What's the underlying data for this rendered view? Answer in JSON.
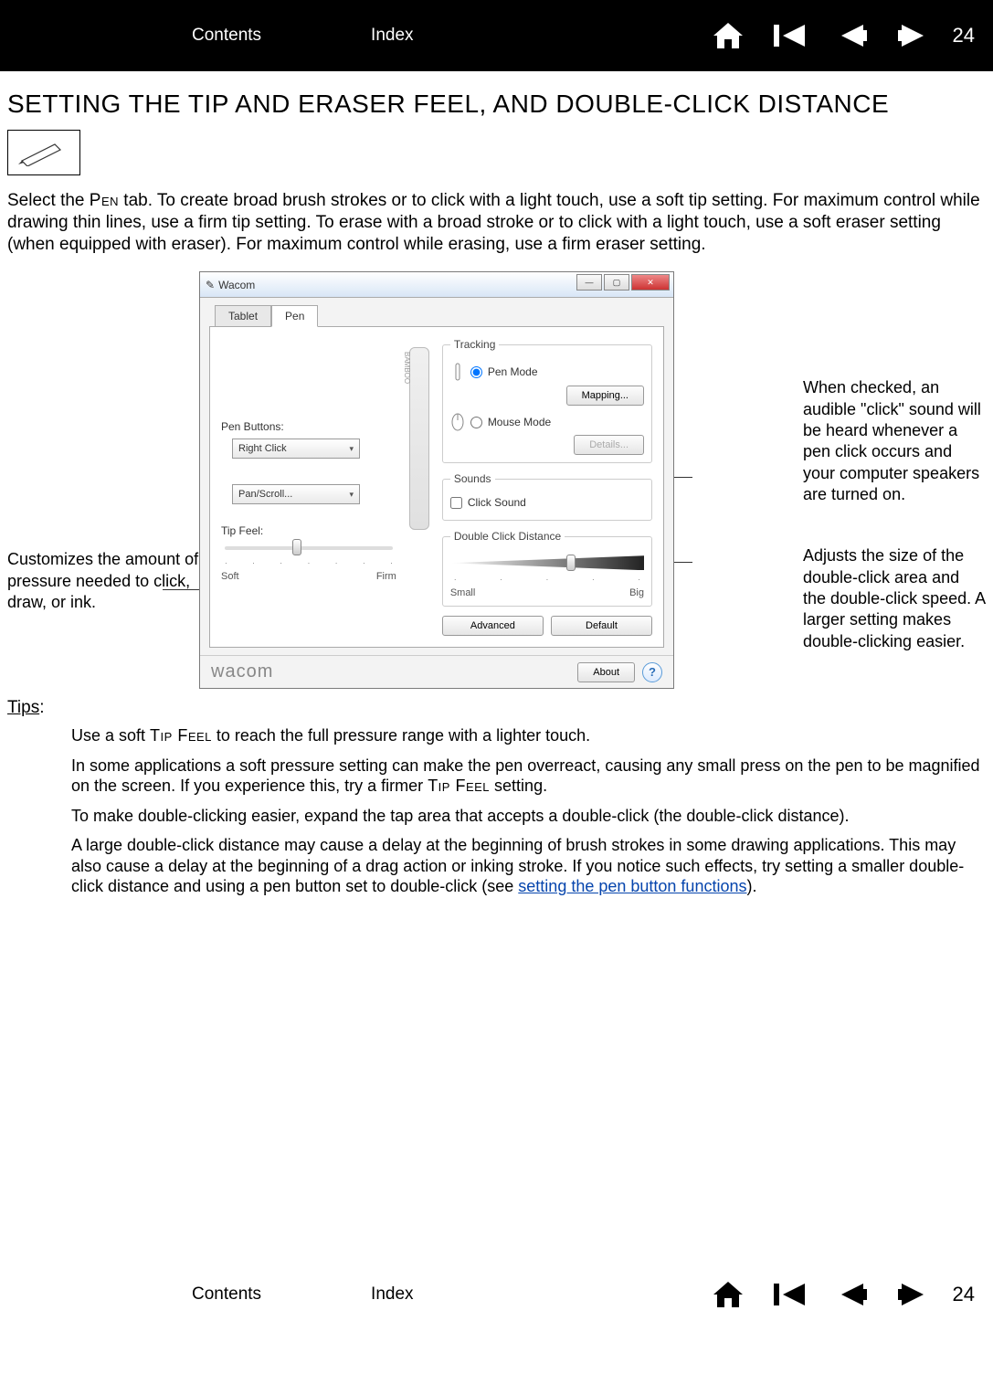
{
  "nav": {
    "contents": "Contents",
    "index": "Index",
    "page_number": "24"
  },
  "heading": "SETTING THE TIP AND ERASER FEEL, AND DOUBLE-CLICK DISTANCE",
  "intro_pre": "Select the ",
  "intro_pen": "Pen",
  "intro_post": " tab. To create broad brush strokes or to click with a light touch, use a soft tip setting. For maximum control while drawing thin lines, use a firm tip setting. To erase with a broad stroke or to click with a light touch, use a soft eraser setting (when equipped with eraser). For maximum control while erasing, use a firm eraser setting.",
  "callouts": {
    "left": "Customizes the amount of pressure needed to click, draw, or ink.",
    "right1": "When checked, an audible \"click\" sound will be heard whenever a pen click occurs and your computer speakers are turned on.",
    "right2": "Adjusts the size of the double-click area and the double-click speed. A larger setting makes double-clicking easier."
  },
  "window": {
    "title": "Wacom",
    "tabs": {
      "tablet": "Tablet",
      "pen": "Pen"
    },
    "pen_buttons_label": "Pen Buttons:",
    "dropdown1": "Right Click",
    "dropdown2": "Pan/Scroll...",
    "tip_feel_label": "Tip Feel:",
    "tip_feel_left": "Soft",
    "tip_feel_right": "Firm",
    "tracking_legend": "Tracking",
    "pen_mode": "Pen Mode",
    "mapping_btn": "Mapping...",
    "mouse_mode": "Mouse Mode",
    "details_btn": "Details...",
    "sounds_legend": "Sounds",
    "click_sound": "Click Sound",
    "dcd_legend": "Double Click Distance",
    "dcd_left": "Small",
    "dcd_right": "Big",
    "advanced_btn": "Advanced",
    "default_btn": "Default",
    "logo": "wacom",
    "about_btn": "About"
  },
  "tips": {
    "title": "Tips",
    "colon": ":",
    "p1_pre": "Use a soft ",
    "p1_tf": "Tip Feel",
    "p1_post": " to reach the full pressure range with a lighter touch.",
    "p2_pre": "In some applications a soft pressure setting can make the pen overreact, causing any small press on the pen to be magnified on the screen. If you experience this, try a firmer ",
    "p2_tf": "Tip Feel",
    "p2_post": " setting.",
    "p3": "To make double-clicking easier, expand the tap area that accepts a double-click (the double-click distance).",
    "p4_pre": "A large double-click distance may cause a delay at the beginning of brush strokes in some drawing applications. This may also cause a delay at the beginning of a drag action or inking stroke. If you notice such effects, try setting a smaller double-click distance and using a pen button set to double-click (see ",
    "p4_link": "setting the pen button functions",
    "p4_post": ")."
  }
}
